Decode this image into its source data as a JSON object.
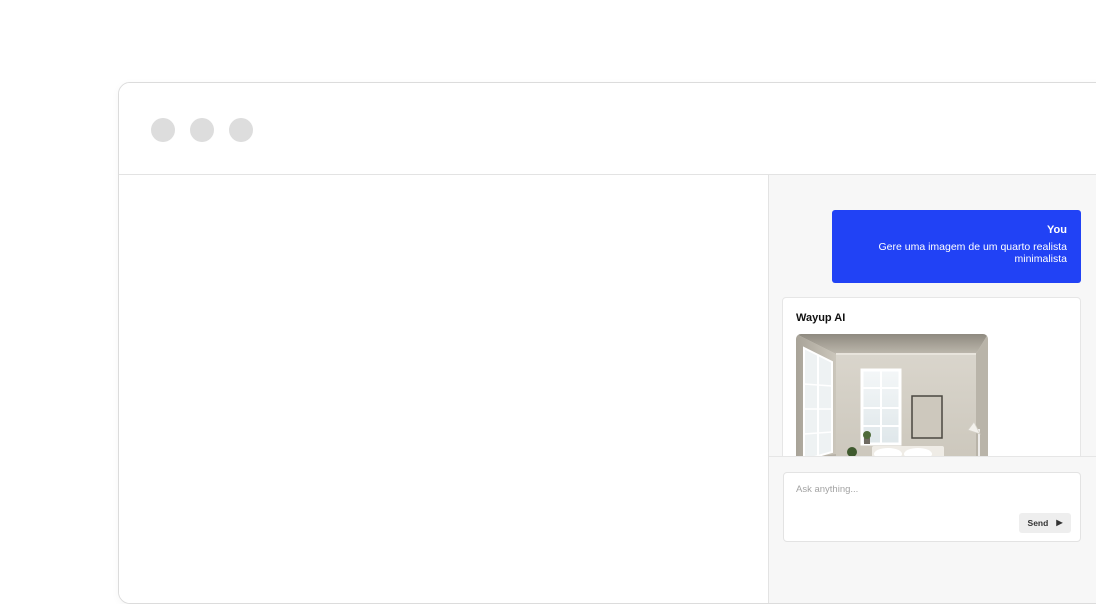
{
  "chat": {
    "user_message": {
      "author": "You",
      "text": "Gere uma imagem de um quarto realista minimalista"
    },
    "ai_message": {
      "author": "Wayup AI",
      "image_icon": "bedroom-image"
    }
  },
  "input": {
    "placeholder": "Ask anything...",
    "value": "",
    "send_label": "Send",
    "send_icon": "play-icon"
  },
  "colors": {
    "user_bubble": "#2142f5",
    "window_dots": "#dddddd",
    "panel_bg": "#f7f7f7"
  }
}
